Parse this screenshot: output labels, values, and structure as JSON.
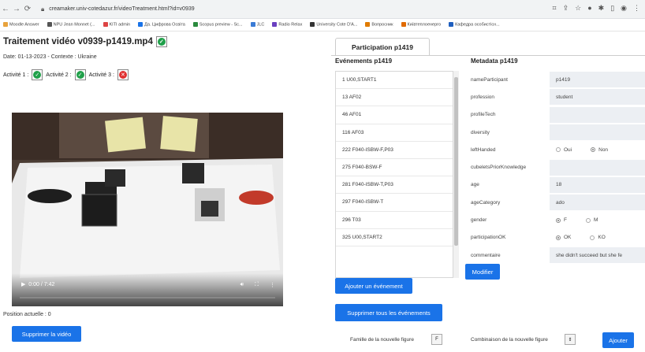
{
  "browser": {
    "url": "creamaker.univ-cotedazur.fr/videoTreatment.html?id=v0939",
    "bookmarks": [
      "Moodle Answer",
      "NPU Jean Monnet (...",
      "KITI admin",
      "Да. Цифрова Освіта",
      "Scopus preview - Sc...",
      "JLC",
      "Radio Relax",
      "University Cote D'A...",
      "Вопросник",
      "Київтеплоенерго",
      "Кафедра особистісн..."
    ]
  },
  "page": {
    "title": "Traitement vidéo v0939-p1419.mp4",
    "date_line": "Date: 01-13-2023 - Contexte : Ukraine",
    "activities": [
      {
        "label": "Activité 1 :",
        "status": "ok"
      },
      {
        "label": "Activité 2 :",
        "status": "ok"
      },
      {
        "label": "Activité 3 :",
        "status": "bad"
      }
    ],
    "video": {
      "time": "0:00 / 7:42",
      "progress": 0.0
    },
    "position_label": "Position actuelle : 0",
    "delete_video_button": "Supprimer la vidéo"
  },
  "panel": {
    "tab_label": "Participation p1419",
    "events_heading": "Evénements p1419",
    "events": [
      "1 U00,START1",
      "13 AF02",
      "46 AF01",
      "116 AF03",
      "222 F040-ISBW-F,P03",
      "275 F040-BSW-F",
      "281 F040-ISBW-T,P03",
      "297 F040-ISBW-T",
      "296 T03",
      "325 U00,START2"
    ],
    "add_event_button": "Ajouter un événement",
    "delete_all_button": "Supprimer tous les événements",
    "metadata_heading": "Metadata p1419",
    "metadata": [
      {
        "key": "nameParticipant",
        "value": "p1419"
      },
      {
        "key": "profession",
        "value": "student"
      },
      {
        "key": "profileTech",
        "value": ""
      },
      {
        "key": "diversity",
        "value": ""
      },
      {
        "key": "leftHanded",
        "type": "radio",
        "options": [
          "Oui",
          "Non"
        ],
        "selected": "Non"
      },
      {
        "key": "cubeletsPriorKnowledge",
        "value": ""
      },
      {
        "key": "age",
        "value": "18"
      },
      {
        "key": "ageCategory",
        "value": "ado"
      },
      {
        "key": "gender",
        "type": "radio",
        "options": [
          "F",
          "M"
        ],
        "selected": "F"
      },
      {
        "key": "participationOK",
        "type": "radio",
        "options": [
          "OK",
          "KO"
        ],
        "selected": "OK"
      },
      {
        "key": "commentaire",
        "value": "she didn't succeed but she fe"
      }
    ],
    "modify_button": "Modifier",
    "family_label": "Famille de la nouvelle figure",
    "family_value": "F",
    "combination_label": "Combinaison de la nouvelle figure",
    "add_button": "Ajouter"
  },
  "colors": {
    "primary": "#1a73e8",
    "ok": "#20a04a",
    "bad": "#e03030"
  }
}
